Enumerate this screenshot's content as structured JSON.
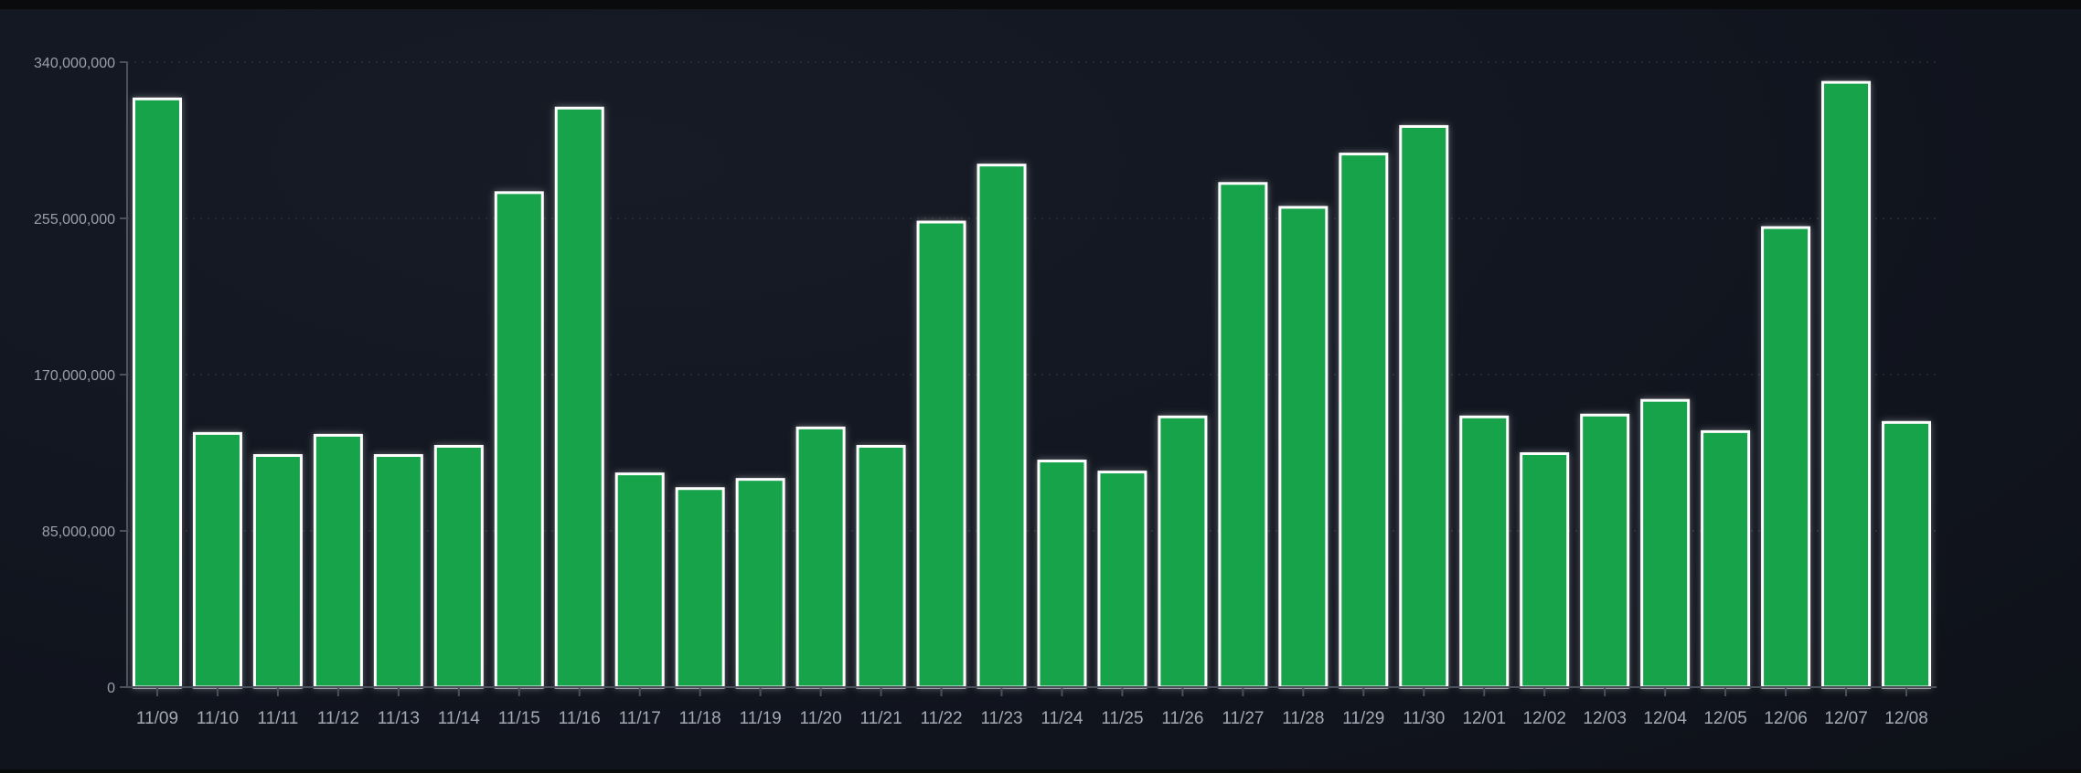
{
  "chart_data": {
    "type": "bar",
    "title": "",
    "xlabel": "",
    "ylabel": "",
    "ylim": [
      0,
      340000000
    ],
    "yticks": [
      0,
      85000000,
      170000000,
      255000000,
      340000000
    ],
    "ytick_labels": [
      "0",
      "85,000,000",
      "170,000,000",
      "255,000,000",
      "340,000,000"
    ],
    "grid": true,
    "categories": [
      "11/09",
      "11/10",
      "11/11",
      "11/12",
      "11/13",
      "11/14",
      "11/15",
      "11/16",
      "11/17",
      "11/18",
      "11/19",
      "11/20",
      "11/21",
      "11/22",
      "11/23",
      "11/24",
      "11/25",
      "11/26",
      "11/27",
      "11/28",
      "11/29",
      "11/30",
      "12/01",
      "12/02",
      "12/03",
      "12/04",
      "12/05",
      "12/06",
      "12/07",
      "12/08"
    ],
    "values": [
      320000000,
      138000000,
      126000000,
      137000000,
      126000000,
      131000000,
      269000000,
      315000000,
      116000000,
      108000000,
      113000000,
      141000000,
      131000000,
      253000000,
      284000000,
      123000000,
      117000000,
      147000000,
      274000000,
      261000000,
      290000000,
      305000000,
      147000000,
      127000000,
      148000000,
      156000000,
      139000000,
      250000000,
      329000000,
      144000000
    ],
    "colors": {
      "bar": "#17a34a",
      "bar_stroke": "#ffffff",
      "axis": "#4a505c",
      "grid": "#2a303a"
    }
  }
}
